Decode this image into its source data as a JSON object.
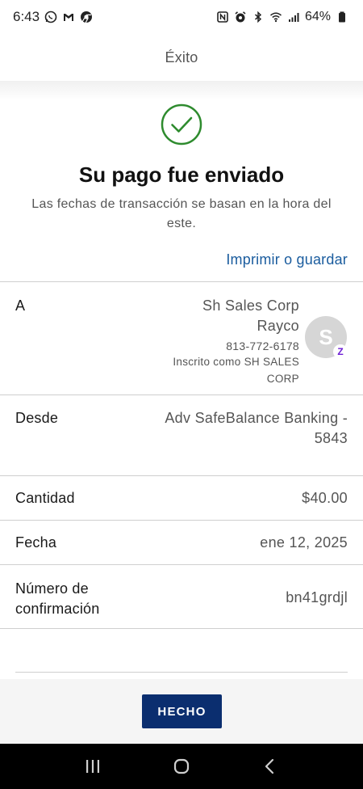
{
  "status_bar": {
    "time": "6:43",
    "battery": "64%",
    "left_icons": [
      "whatsapp-icon",
      "gmail-icon",
      "chrome-icon"
    ],
    "right_icons": [
      "nfc-icon",
      "alarm-icon",
      "bluetooth-icon",
      "wifi-icon",
      "signal-icon",
      "battery-icon"
    ]
  },
  "header": {
    "title": "Éxito"
  },
  "success": {
    "icon": "check-circle-icon",
    "title": "Su pago fue enviado",
    "subtitle": "Las fechas de transacción se basan en la hora del este."
  },
  "print_link": "Imprimir o guardar",
  "recipient": {
    "label": "A",
    "name_line1": "Sh Sales Corp",
    "name_line2": "Rayco",
    "phone": "813-772-6178",
    "enrolled_line1": "Inscrito como SH SALES",
    "enrolled_line2": "CORP",
    "avatar_initial": "S",
    "badge_glyph": "Z"
  },
  "from": {
    "label": "Desde",
    "value_line1": "Adv SafeBalance Banking -",
    "value_line2": "5843"
  },
  "amount": {
    "label": "Cantidad",
    "value": "$40.00"
  },
  "date": {
    "label": "Fecha",
    "value": "ene 12, 2025"
  },
  "confirmation": {
    "label_line1": "Número de",
    "label_line2": "confirmación",
    "value": "bn41grdjl"
  },
  "done_button": "HECHO",
  "colors": {
    "accent_link": "#1a5c9e",
    "button_bg": "#0b2e6f",
    "success_green": "#2e8b2e",
    "zelle_purple": "#6d1ed4"
  }
}
